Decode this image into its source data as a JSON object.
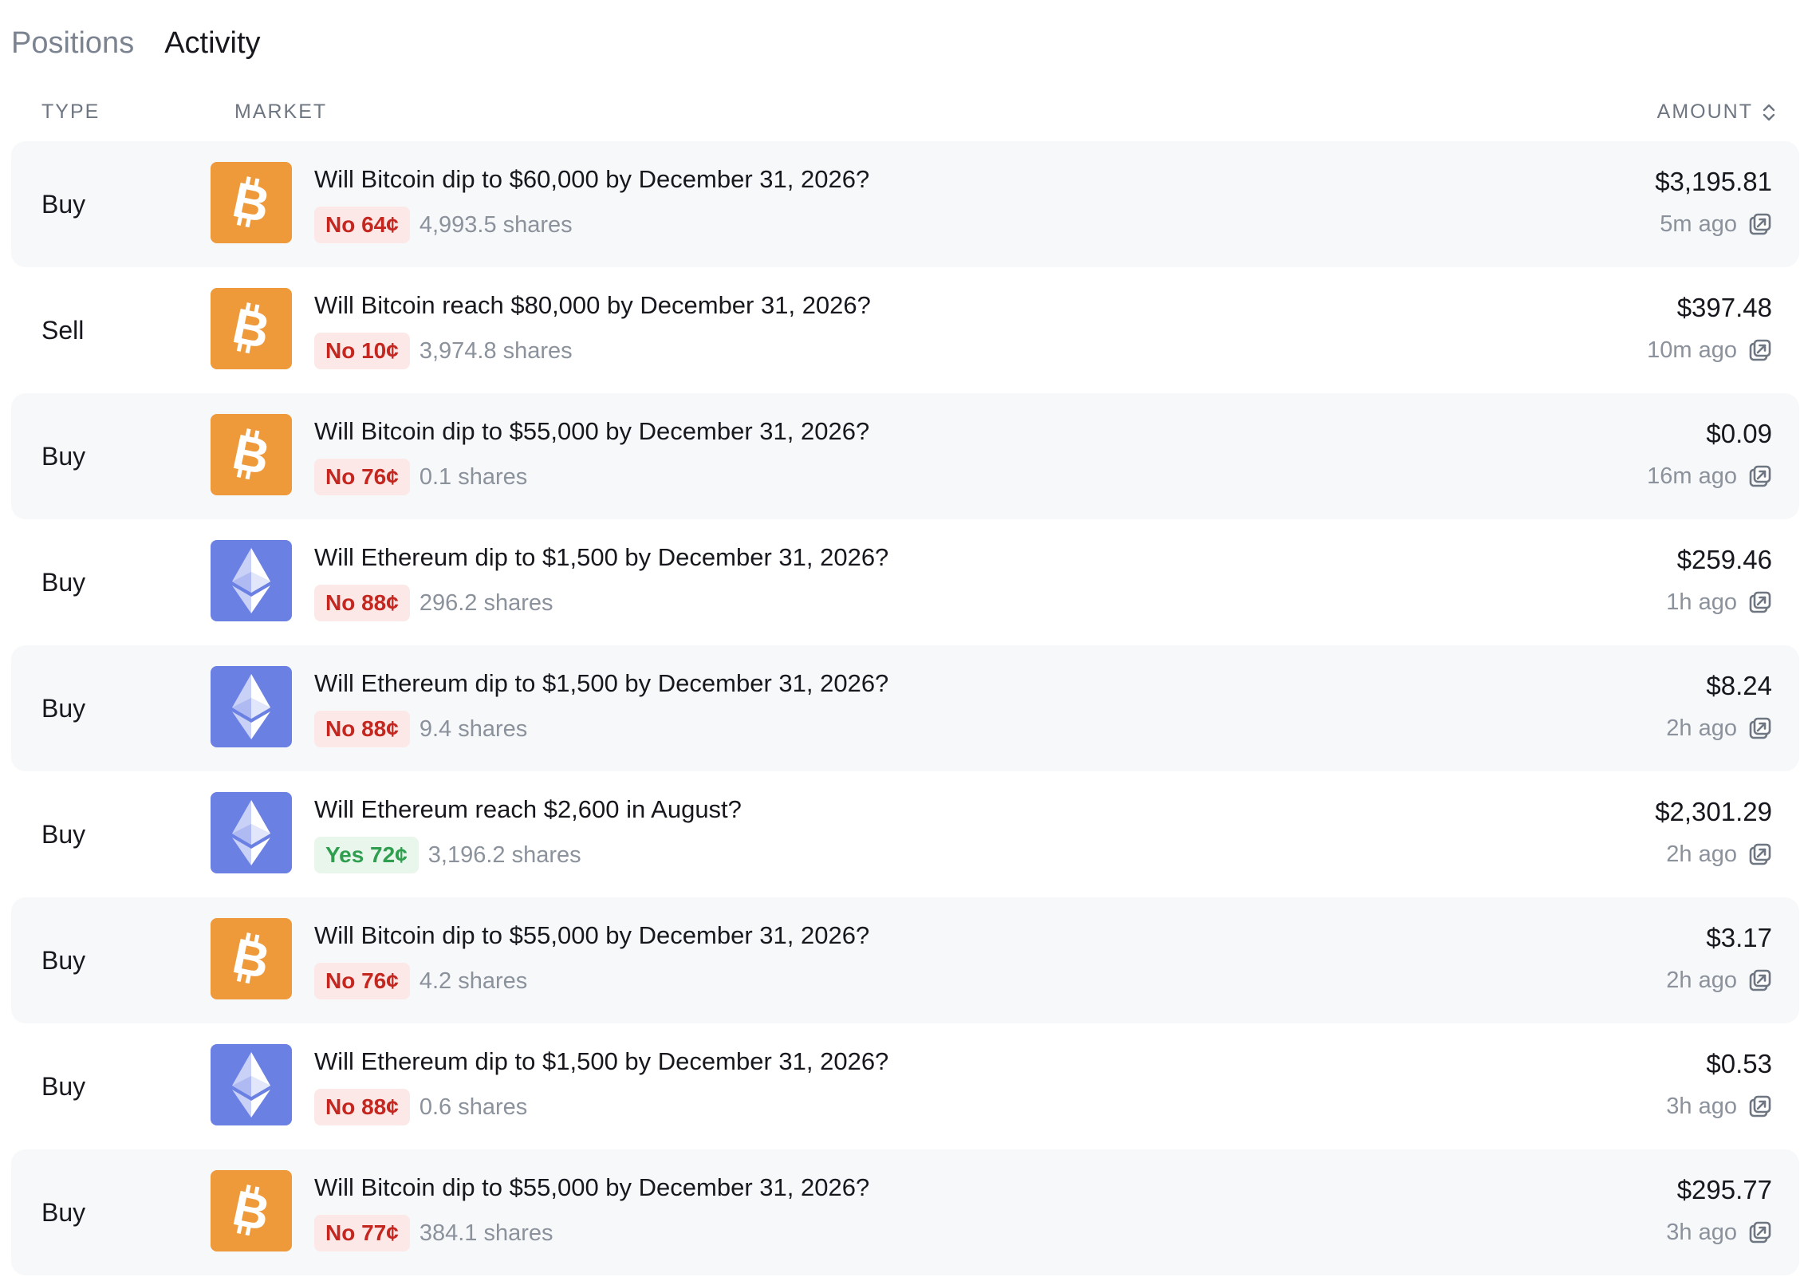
{
  "tabs": [
    {
      "label": "Positions",
      "active": false
    },
    {
      "label": "Activity",
      "active": true
    }
  ],
  "columns": {
    "type": "TYPE",
    "market": "MARKET",
    "amount": "AMOUNT"
  },
  "colors": {
    "bitcoin": "#ee9a3a",
    "ethereum": "#6b80e3",
    "no_text": "#c4271f",
    "no_bg": "#fde8e8",
    "yes_text": "#2f9e4f",
    "yes_bg": "#e8f6ec",
    "row_shade": "#f7f8fa"
  },
  "rows": [
    {
      "type": "Buy",
      "coin": "bitcoin-icon",
      "market": "Will Bitcoin dip to $60,000 by December 31, 2026?",
      "outcome": "No 64¢",
      "outcome_kind": "no",
      "shares": "4,993.5 shares",
      "amount": "$3,195.81",
      "time": "5m ago"
    },
    {
      "type": "Sell",
      "coin": "bitcoin-icon",
      "market": "Will Bitcoin reach $80,000 by December 31, 2026?",
      "outcome": "No 10¢",
      "outcome_kind": "no",
      "shares": "3,974.8 shares",
      "amount": "$397.48",
      "time": "10m ago"
    },
    {
      "type": "Buy",
      "coin": "bitcoin-icon",
      "market": "Will Bitcoin dip to $55,000 by December 31, 2026?",
      "outcome": "No 76¢",
      "outcome_kind": "no",
      "shares": "0.1 shares",
      "amount": "$0.09",
      "time": "16m ago"
    },
    {
      "type": "Buy",
      "coin": "ethereum-icon",
      "market": "Will Ethereum dip to $1,500 by December 31, 2026?",
      "outcome": "No 88¢",
      "outcome_kind": "no",
      "shares": "296.2 shares",
      "amount": "$259.46",
      "time": "1h ago"
    },
    {
      "type": "Buy",
      "coin": "ethereum-icon",
      "market": "Will Ethereum dip to $1,500 by December 31, 2026?",
      "outcome": "No 88¢",
      "outcome_kind": "no",
      "shares": "9.4 shares",
      "amount": "$8.24",
      "time": "2h ago"
    },
    {
      "type": "Buy",
      "coin": "ethereum-icon",
      "market": "Will Ethereum reach $2,600 in August?",
      "outcome": "Yes 72¢",
      "outcome_kind": "yes",
      "shares": "3,196.2 shares",
      "amount": "$2,301.29",
      "time": "2h ago"
    },
    {
      "type": "Buy",
      "coin": "bitcoin-icon",
      "market": "Will Bitcoin dip to $55,000 by December 31, 2026?",
      "outcome": "No 76¢",
      "outcome_kind": "no",
      "shares": "4.2 shares",
      "amount": "$3.17",
      "time": "2h ago"
    },
    {
      "type": "Buy",
      "coin": "ethereum-icon",
      "market": "Will Ethereum dip to $1,500 by December 31, 2026?",
      "outcome": "No 88¢",
      "outcome_kind": "no",
      "shares": "0.6 shares",
      "amount": "$0.53",
      "time": "3h ago"
    },
    {
      "type": "Buy",
      "coin": "bitcoin-icon",
      "market": "Will Bitcoin dip to $55,000 by December 31, 2026?",
      "outcome": "No 77¢",
      "outcome_kind": "no",
      "shares": "384.1 shares",
      "amount": "$295.77",
      "time": "3h ago"
    }
  ]
}
